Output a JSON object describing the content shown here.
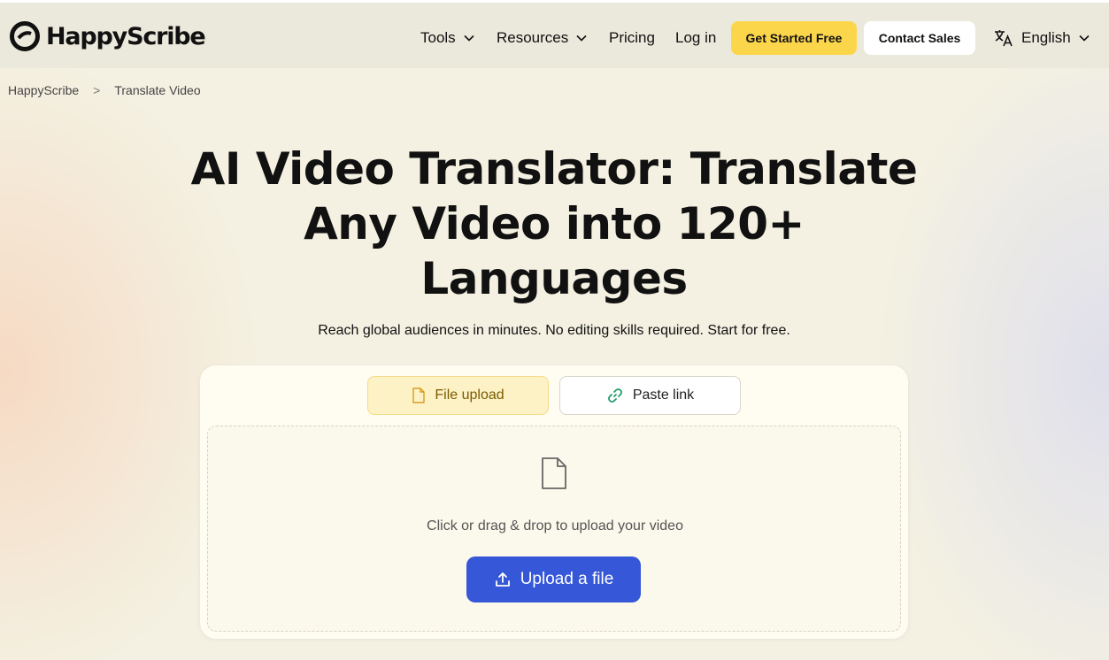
{
  "header": {
    "brand": "HappyScribe",
    "nav": [
      {
        "label": "Tools",
        "has_dropdown": true
      },
      {
        "label": "Resources",
        "has_dropdown": true
      },
      {
        "label": "Pricing",
        "has_dropdown": false
      },
      {
        "label": "Log in",
        "has_dropdown": false
      }
    ],
    "cta_primary": "Get Started Free",
    "cta_secondary": "Contact Sales",
    "language": "English"
  },
  "breadcrumb": {
    "items": [
      "HappyScribe",
      "Translate Video"
    ],
    "separator": ">"
  },
  "hero": {
    "title_lines": [
      "AI Video Translator: Translate",
      "Any Video into 120+",
      "Languages"
    ],
    "subtitle": "Reach global audiences in minutes. No editing skills required. Start for free."
  },
  "uploader": {
    "tabs": [
      {
        "label": "File upload",
        "active": true,
        "icon": "file-icon"
      },
      {
        "label": "Paste link",
        "active": false,
        "icon": "link-icon"
      }
    ],
    "drop_text": "Click or drag & drop to upload your video",
    "upload_button": "Upload a file"
  },
  "colors": {
    "accent_yellow": "#fcd64a",
    "upload_blue": "#3557d8",
    "link_green": "#1f9e6a"
  }
}
